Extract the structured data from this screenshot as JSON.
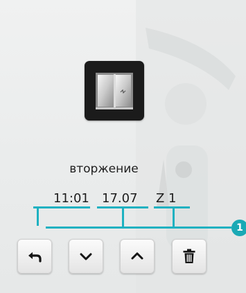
{
  "event": {
    "type_label": "вторжение",
    "time": "11:01",
    "date": "17.07",
    "zone": "Z 1"
  },
  "callout": {
    "number": "1"
  },
  "icons": {
    "event_icon": "window-open-icon",
    "back": "back-arrow-icon",
    "down": "chevron-down-icon",
    "up": "chevron-up-icon",
    "delete": "trash-icon"
  },
  "colors": {
    "accent": "#1db1c1",
    "badge": "#1aa9b5",
    "icon_tile": "#1b1b1b",
    "text": "#1e1e1e"
  }
}
